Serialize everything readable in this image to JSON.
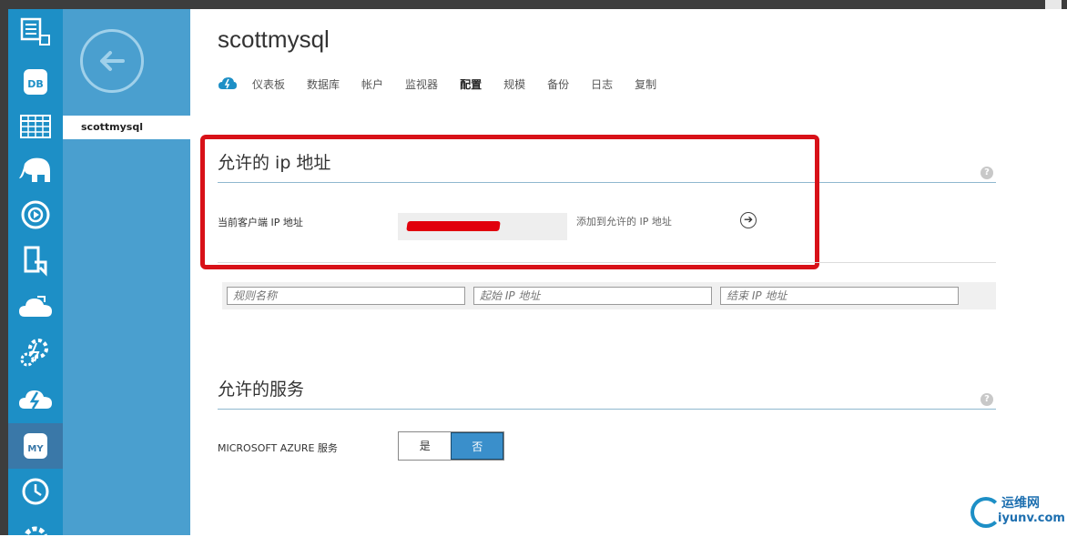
{
  "page": {
    "title": "scottmysql"
  },
  "sidebar": {
    "items": [
      {
        "icon": "list-icon"
      },
      {
        "icon": "db-icon",
        "label": "DB"
      },
      {
        "icon": "table-icon"
      },
      {
        "icon": "hdinsight-elephant-icon"
      },
      {
        "icon": "media-services-icon"
      },
      {
        "icon": "mobile-services-icon"
      },
      {
        "icon": "cloud-services-icon"
      },
      {
        "icon": "gear-icon"
      },
      {
        "icon": "cloud-lightning-icon"
      },
      {
        "icon": "mysql-icon",
        "label": "MY",
        "active": true
      },
      {
        "icon": "scheduler-clock-icon"
      },
      {
        "icon": "settings-gear-icon"
      }
    ]
  },
  "subnav": {
    "active_item": "scottmysql"
  },
  "tabs": [
    "仪表板",
    "数据库",
    "帐户",
    "监视器",
    "配置",
    "规模",
    "备份",
    "日志",
    "复制"
  ],
  "active_tab": "配置",
  "allowed_ip": {
    "section_title": "允许的 ip 地址",
    "current_ip_label": "当前客户端 IP 地址",
    "add_link": "添加到允许的 IP 地址",
    "help": "?",
    "arrow": "➔"
  },
  "rule_row": {
    "name_placeholder": "规则名称",
    "start_placeholder": "起始 IP 地址",
    "end_placeholder": "结束 IP 地址"
  },
  "allowed_services": {
    "section_title": "允许的服务",
    "azure_label": "MICROSOFT AZURE 服务",
    "yes": "是",
    "no": "否",
    "selected": "否",
    "help": "?"
  },
  "watermark": {
    "cn": "运维网",
    "url": "iyunv.com"
  },
  "colors": {
    "accent": "#1d8fc6",
    "highlight": "#d81118",
    "selected": "#3a8fcb"
  }
}
